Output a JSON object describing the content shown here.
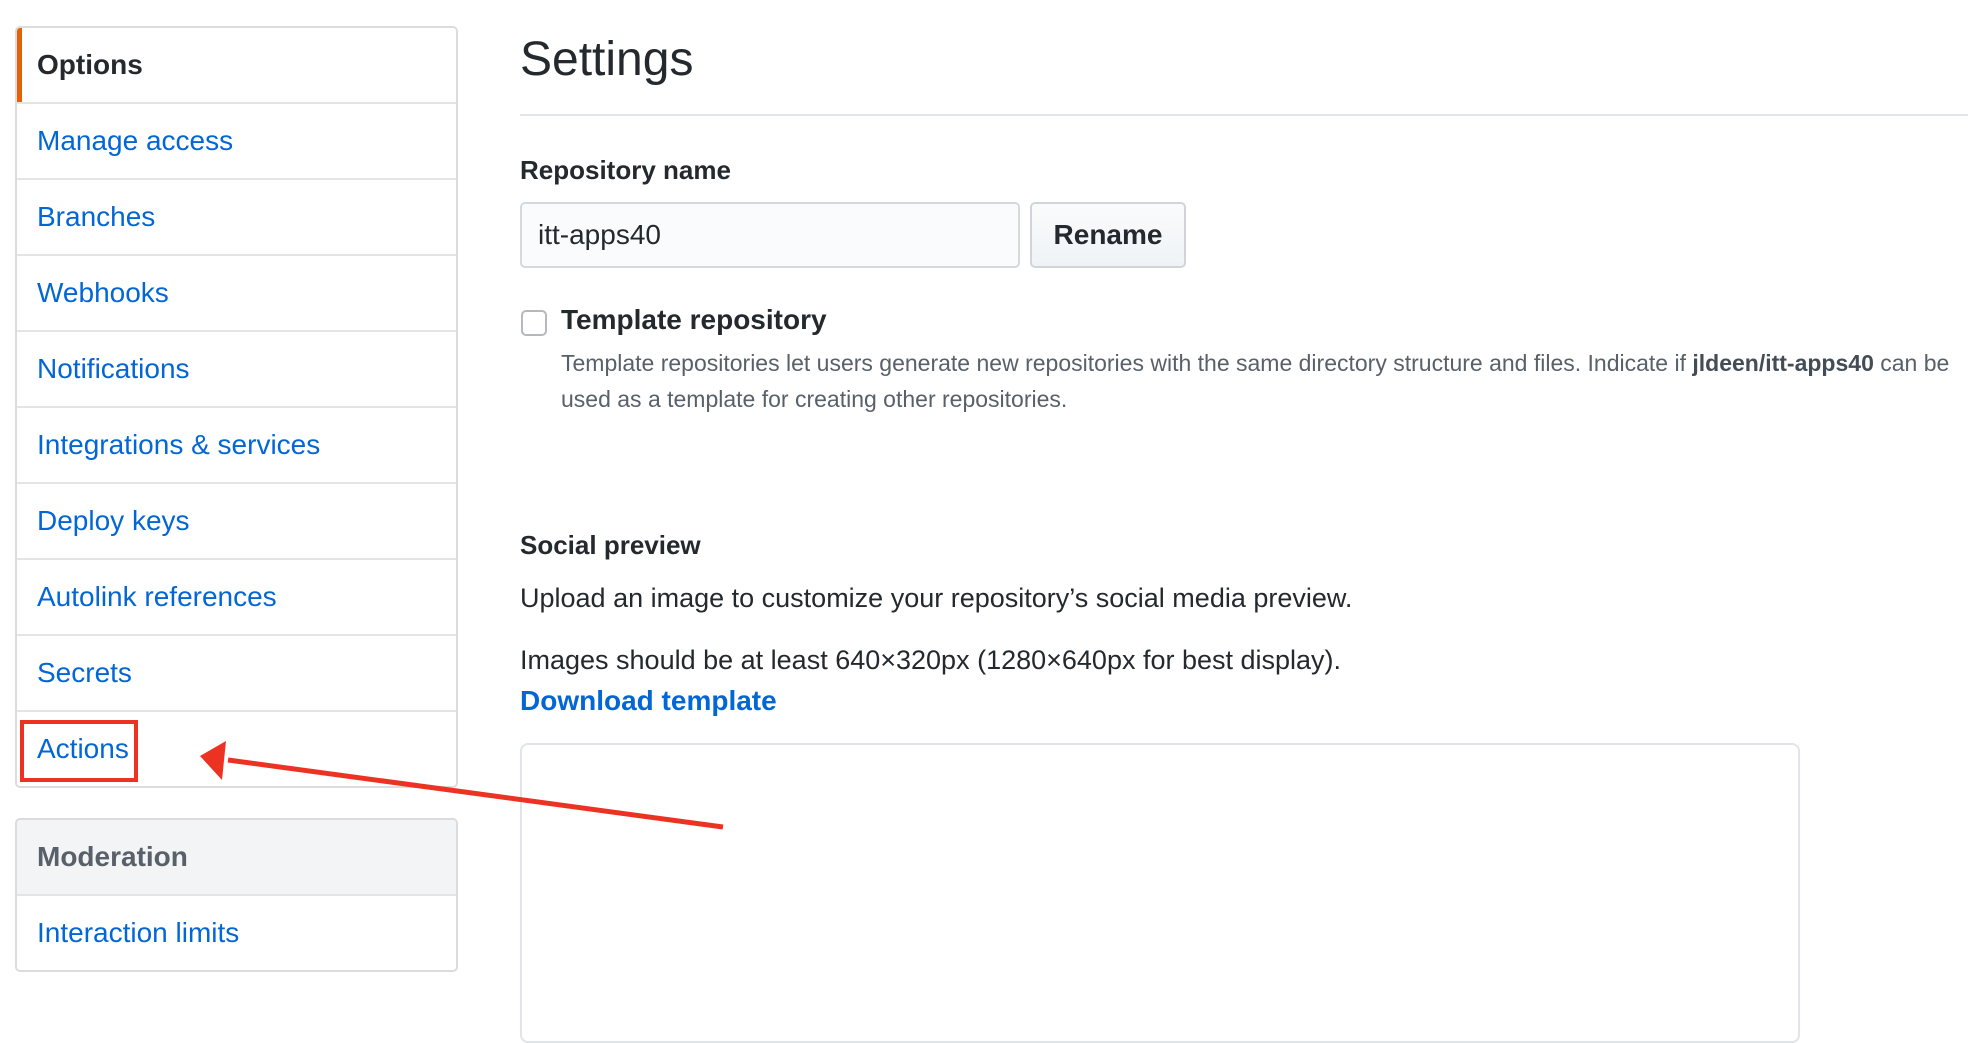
{
  "sidebar": {
    "options_menu": [
      {
        "label": "Options",
        "selected": true
      },
      {
        "label": "Manage access"
      },
      {
        "label": "Branches"
      },
      {
        "label": "Webhooks"
      },
      {
        "label": "Notifications"
      },
      {
        "label": "Integrations & services"
      },
      {
        "label": "Deploy keys"
      },
      {
        "label": "Autolink references"
      },
      {
        "label": "Secrets"
      },
      {
        "label": "Actions",
        "highlighted": true
      }
    ],
    "moderation_menu": {
      "heading": "Moderation",
      "items": [
        {
          "label": "Interaction limits"
        }
      ]
    }
  },
  "main": {
    "title": "Settings",
    "repo_name": {
      "label": "Repository name",
      "value": "itt-apps40",
      "rename_button": "Rename"
    },
    "template": {
      "label": "Template repository",
      "checked": false,
      "note_pre": "Template repositories let users generate new repositories with the same directory structure and files. Indicate if ",
      "note_repo": "jldeen/itt-apps40",
      "note_post": " can be used as a template for creating other repositories."
    },
    "social_preview": {
      "heading": "Social preview",
      "description": "Upload an image to customize your repository’s social media preview.",
      "size_hint": "Images should be at least 640×320px (1280×640px for best display).",
      "download_link": "Download template"
    }
  },
  "annotation": {
    "color": "#ec3323",
    "target": "Actions"
  }
}
